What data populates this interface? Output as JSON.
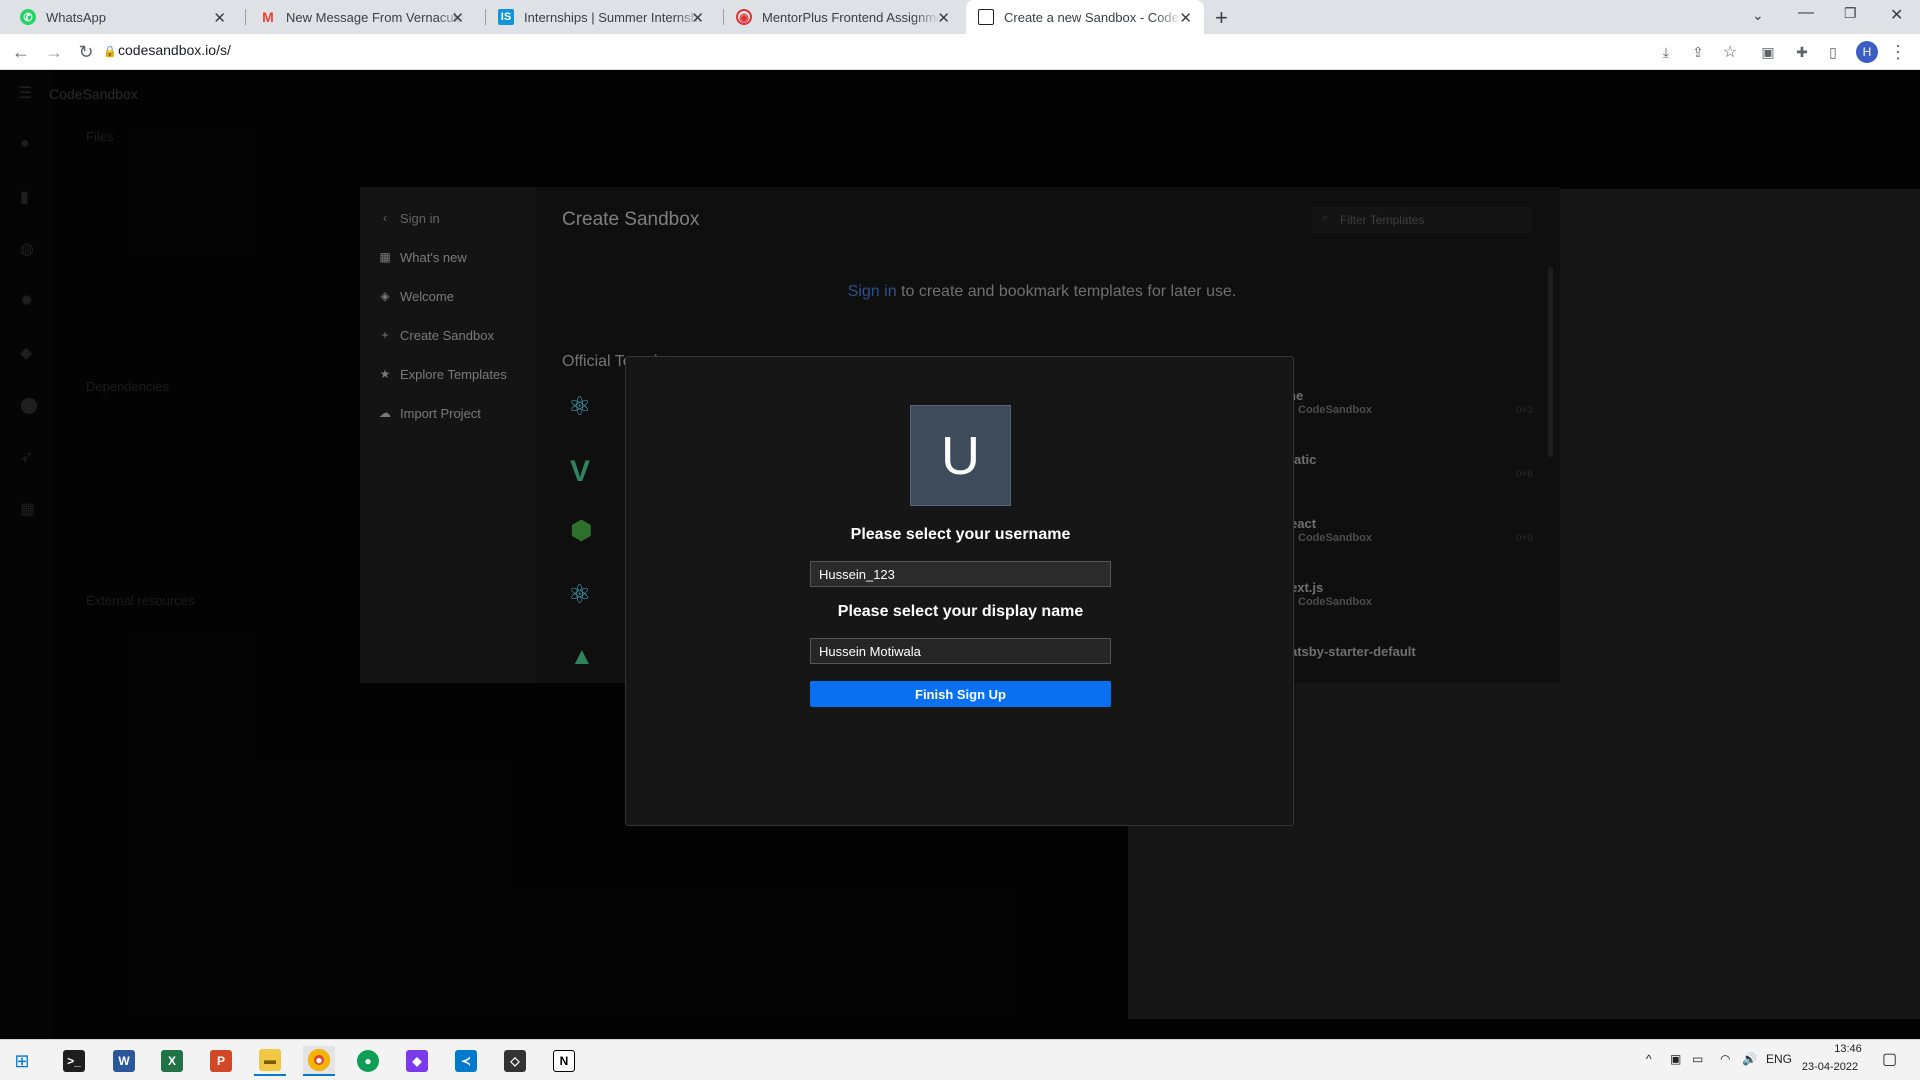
{
  "tabs": [
    {
      "title": "WhatsApp",
      "icon": "whatsapp-icon",
      "color": "#25d366"
    },
    {
      "title": "New Message From Vernacular In",
      "icon": "gmail-icon",
      "color": "#ea4335"
    },
    {
      "title": "Internships | Summer Internship",
      "icon": "internshala-icon",
      "color": "#1295d8"
    },
    {
      "title": "MentorPlus Frontend Assignment",
      "icon": "mentorplus-icon",
      "color": "#e03434"
    },
    {
      "title": "Create a new Sandbox - CodeSan",
      "icon": "codesandbox-icon",
      "color": "#202124"
    }
  ],
  "address": {
    "url": "codesandbox.io/s/"
  },
  "profile_initial": "H",
  "app": {
    "brand": "CodeSandbox",
    "files_label": "Files",
    "dependencies_label": "Dependencies",
    "external_label": "External resources"
  },
  "create_sandbox": {
    "back_label": "Sign in",
    "title": "Create Sandbox",
    "filter_placeholder": "Filter Templates",
    "sign_in_link": "Sign in",
    "sign_in_text": " to create and bookmark templates for later use.",
    "official_label": "Official Templates",
    "nav": [
      {
        "label": "What's new",
        "icon": "grid-icon"
      },
      {
        "label": "Welcome",
        "icon": "cube-icon"
      },
      {
        "label": "Create Sandbox",
        "icon": "plus-icon"
      },
      {
        "label": "Explore Templates",
        "icon": "star-icon"
      },
      {
        "label": "Import Project",
        "icon": "cloud-icon"
      }
    ],
    "right_templates": [
      {
        "name": "ne",
        "by": "CodeSandbox",
        "meta": "0+3"
      },
      {
        "name": "atic",
        "by": "",
        "meta": "0+6"
      },
      {
        "name": "eact",
        "by": "CodeSandbox",
        "meta": "0+9"
      },
      {
        "name": "ext.js",
        "by": "CodeSandbox",
        "meta": ""
      },
      {
        "name": "atsby-starter-default",
        "by": "",
        "meta": ""
      }
    ]
  },
  "signup": {
    "avatar_letter": "U",
    "username_label": "Please select your username",
    "username_value": "Hussein_123",
    "display_label": "Please select your display name",
    "display_value": "Hussein Motiwala",
    "finish_label": "Finish Sign Up"
  },
  "tray": {
    "lang": "ENG",
    "time": "13:46",
    "date": "23-04-2022"
  }
}
